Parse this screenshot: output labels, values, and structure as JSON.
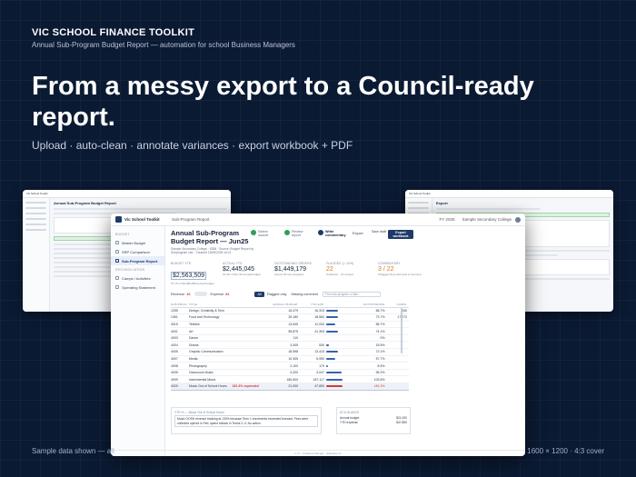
{
  "hero": {
    "brand": "VIC SCHOOL FINANCE TOOLKIT",
    "subtitle": "Annual Sub-Program Budget Report — automation for school Business Managers",
    "headline": "From a messy export to a Council-ready report.",
    "tagline": "Upload · auto-clean · annotate variances · export workbook + PDF",
    "footer_left": "Sample data shown — all",
    "footer_right": "1600 × 1200 · 4:3 cover"
  },
  "side_left": {
    "app_name": "Vic School Toolkit",
    "title": "Annual Sub-Program Budget Report"
  },
  "side_right": {
    "app_name": "Vic School Toolkit",
    "title": "Export"
  },
  "app": {
    "logo_name": "Vic School Toolkit",
    "breadcrumb": "Sub-Program Report",
    "fy": "FY 2025",
    "school": "Sample Secondary College"
  },
  "sidebar": {
    "group1": "BUDGET",
    "group2": "RECONCILIATION",
    "items": [
      {
        "label": "Master Budget",
        "active": false
      },
      {
        "label": "SRP Comparison",
        "active": false
      },
      {
        "label": "Sub-Program Report",
        "active": true
      },
      {
        "label": "Camps / Activities",
        "active": false
      },
      {
        "label": "Operating Statement",
        "active": false
      }
    ]
  },
  "report": {
    "title": "Annual Sub-Program Budget Report — Jun25",
    "meta": "Sample Secondary College · 8286 · Source: Budget Report by Subprogram.xlsx · Cleaned 16/06/2025 16:21",
    "steps": [
      {
        "label": "Select source",
        "state": "done"
      },
      {
        "label": "Review report",
        "state": "done"
      },
      {
        "label": "Write commentary",
        "state": "current"
      }
    ],
    "export_link": "Export",
    "save_draft": "Save draft",
    "export_button": "Export workbook"
  },
  "kpis": [
    {
      "label": "BUDGET YTD",
      "value": "$2,563,509",
      "note": "57.1% of $4,486,898 annual budget"
    },
    {
      "label": "ACTUAL YTD",
      "value": "$2,445,045",
      "note": "51.9% of $4,710 annual budget"
    },
    {
      "label": "OUTSTANDING ORDERS",
      "value": "$1,449,179",
      "note": "Across 81 sub-programs"
    },
    {
      "label": "FLAGGED (> 10%)",
      "value": "22",
      "note": "9 adverse · 13 revision"
    },
    {
      "label": "COMMENTARY",
      "value": "3 / 22",
      "note": "5 flagged lines still need a comment"
    }
  ],
  "filters": {
    "revenue_label": "Revenue",
    "revenue_count": "16",
    "expense_label": "Expense",
    "expense_count": "81",
    "all": "All",
    "flagged": "Flagged only",
    "missing": "Missing comment",
    "search_placeholder": "Find sub-program or title..."
  },
  "table": {
    "headers": [
      "SUB-PROG",
      "TITLE",
      "ANNUAL BUDGET",
      "YTD EXP.",
      "",
      "OUTSTANDING",
      "COMM."
    ],
    "rows": [
      {
        "code": "1255",
        "title": "Design, Creativity & Tech",
        "budget": "16,479",
        "ytd": "16,315",
        "pct": "68.7%",
        "outstanding": "430",
        "bar": 0.7,
        "red": false
      },
      {
        "code": "1351",
        "title": "Food and Technology",
        "budget": "25,180",
        "ytd": "18,560",
        "pct": "73.7%",
        "outstanding": "17,272",
        "bar": 0.74,
        "red": false
      },
      {
        "code": "4015",
        "title": "Textiles",
        "budget": "13,545",
        "ytd": "12,000",
        "pct": "58.7%",
        "outstanding": "",
        "bar": 0.58,
        "red": false
      },
      {
        "code": "4001",
        "title": "Art",
        "budget": "55,875",
        "ytd": "41,393",
        "pct": "74.1%",
        "outstanding": "",
        "bar": 0.74,
        "red": false
      },
      {
        "code": "4003",
        "title": "Dance",
        "budget": "110",
        "ytd": "",
        "pct": "0%",
        "outstanding": "",
        "bar": 0,
        "red": false
      },
      {
        "code": "4004",
        "title": "Drama",
        "budget": "3,405",
        "ytd": "530",
        "pct": "15.5%",
        "outstanding": "",
        "bar": 0.16,
        "red": false
      },
      {
        "code": "4005",
        "title": "Graphic Communication",
        "budget": "18,598",
        "ytd": "13,415",
        "pct": "72.1%",
        "outstanding": "",
        "bar": 0.72,
        "red": false
      },
      {
        "code": "4007",
        "title": "Media",
        "budget": "10,305",
        "ytd": "5,950",
        "pct": "57.7%",
        "outstanding": "",
        "bar": 0.58,
        "red": false
      },
      {
        "code": "4008",
        "title": "Photography",
        "budget": "2,100",
        "ytd": "179",
        "pct": "8.5%",
        "outstanding": "",
        "bar": 0.09,
        "red": false
      },
      {
        "code": "4005",
        "title": "Classroom Music",
        "budget": "3,200",
        "ytd": "3,047",
        "pct": "95.2%",
        "outstanding": "",
        "bar": 0.95,
        "red": false
      },
      {
        "code": "4009",
        "title": "Instrumental Music",
        "budget": "180,600",
        "ytd": "187,117",
        "pct": "103.6%",
        "outstanding": "",
        "bar": 1.0,
        "red": false
      },
      {
        "code": "4020",
        "title": "Music Out of School Hours",
        "budget": "21,000",
        "ytd": "47,850",
        "pct": "181.3%",
        "outstanding": "",
        "bar": 1.0,
        "red": true
      }
    ],
    "selected_row": {
      "code": "4020",
      "title": "Music Out of School Hours",
      "alert": "181.3% expended"
    }
  },
  "note": {
    "title": "YTD % — Music Out of School Hours",
    "text": "Music OOSH revenue tracking at 134% because Term 1 enrolments exceeded forecast. Fees were collected upfront in Feb; spend follows in Terms 2–4. No action."
  },
  "side_panel": {
    "title": "AT A GLANCE",
    "rows": [
      {
        "label": "Annual budget",
        "value": "$21,000"
      },
      {
        "label": "YTD expense",
        "value": "$47,850"
      }
    ]
  },
  "status_bar": "1 / 3 · Unsaved changes · Autosave on"
}
